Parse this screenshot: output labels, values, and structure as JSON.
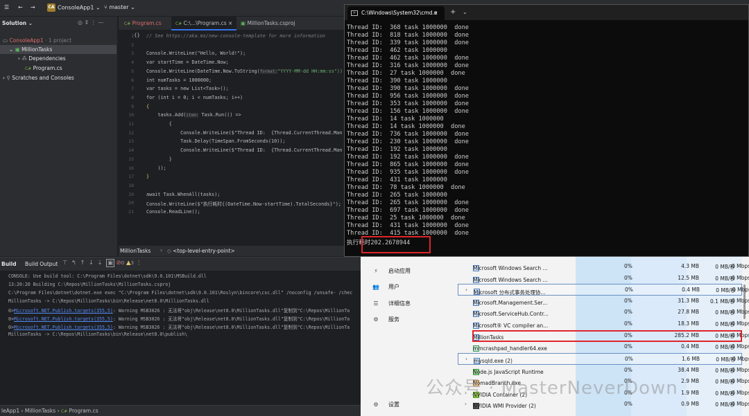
{
  "titlebar": {
    "project": "ConsoleApp1",
    "badge": "CA",
    "branch": "master"
  },
  "solution": {
    "header": "Solution",
    "rows": [
      {
        "label": "ConsoleApp1",
        "note": " · 1 project"
      },
      {
        "label": "MillionTasks"
      },
      {
        "label": "Dependencies"
      },
      {
        "label": "Program.cs"
      },
      {
        "label": "Scratches and Consoles"
      }
    ]
  },
  "tabs": [
    {
      "label": "Program.cs"
    },
    {
      "label": "C:\\...\\Program.cs"
    },
    {
      "label": "MillionTasks.csproj"
    }
  ],
  "editor": {
    "lines": [
      "1",
      "2",
      "3",
      "4",
      "5",
      "6",
      "7",
      "8",
      "9",
      "10",
      "11",
      "12",
      "13",
      "14",
      "15",
      "16",
      "17",
      "18",
      "19",
      "20",
      "21"
    ],
    "comment": "// See https://aka.ms/new-console-template for more information",
    "code": [
      "Console.WriteLine(\"Hello, World!\");",
      "var startTime = DateTime.Now;",
      "Console.WriteLine(DateTime.Now.ToString(",
      "int numTasks = 1000000;",
      "var tasks = new List<Task>();",
      "for (int i = 0; i < numTasks; i++)",
      "{",
      "    tasks.Add(",
      "        {",
      "            Console.WriteLine($\"Thread ID:  {Thread.CurrentThread.Man",
      "            Task.Delay(TimeSpan.FromSeconds(10));",
      "            Console.WriteLine($\"Thread ID:  {Thread.CurrentThread.Man",
      "        }",
      "    ));",
      "}",
      "await Task.WhenAll(tasks);",
      "Console.WriteLine($\"执行耗时{(DateTime.Now-startTime).TotalSeconds}\");",
      "Console.ReadLine();"
    ],
    "hint_format": "format:",
    "format_str": "\"YYYY-MM-dd HH:mm:ss\"))",
    "hint_item": "item:",
    "task_run": "Task.Run(() =>"
  },
  "breadcrumb": {
    "project": "MillionTasks",
    "entry": "<top-level-entry-point>"
  },
  "build": {
    "tab1": "Build",
    "tab2": "Build Output",
    "errors": "0",
    "warnings": "3",
    "lines": [
      "CONSOLE: Use build tool: C:\\Program Files\\dotnet\\sdk\\9.0.101\\MSBuild.dll",
      "13:20:20 Building C:\\Repos\\MillionTasks\\MillionTasks.csproj",
      "C:\\Program Files\\dotnet\\dotnet.exe exec \"C:\\Program Files\\dotnet\\sdk\\9.0.101\\Roslyn\\bincore\\csc.dll\" /noconfig /unsafe- /chec",
      "MillionTasks -> C:\\Repos\\MillionTasks\\bin\\Release\\net8.0\\MillionTasks.dll"
    ],
    "warn_prefix": "0>",
    "warn_link": "Microsoft.NET.Publish.targets(355,5)",
    "warnings_text": [
      ": Warning MSB3026 : 无法将\"obj\\Release\\net8.0\\MillionTasks.dll\"复制到\"C:\\Repos\\MillionTa",
      ": Warning MSB3026 : 无法将\"obj\\Release\\net8.0\\MillionTasks.dll\"复制到\"C:\\Repos\\MillionTa",
      ": Warning MSB3026 : 无法将\"obj\\Release\\net8.0\\MillionTasks.dll\"复制到\"C:\\Repos\\MillionTa"
    ],
    "last": "MillionTasks -> C:\\Repos\\MillionTasks\\bin\\Release\\net8.0\\publish\\"
  },
  "status": {
    "a": "leApp1",
    "b": "MillionTasks",
    "c": "Program.cs"
  },
  "cmd": {
    "title": "C:\\Windows\\System32\\cmd.e",
    "lines": [
      "Thread ID:  368 task 1000000  done",
      "Thread ID:  818 task 1000000  done",
      "Thread ID:  339 task 1000000  done",
      "Thread ID:  462 task 1000000",
      "Thread ID:  462 task 1000000  done",
      "Thread ID:  316 task 1000000  done",
      "Thread ID:  27 task 1000000  done",
      "Thread ID:  390 task 1000000",
      "Thread ID:  390 task 1000000  done",
      "Thread ID:  956 task 1000000  done",
      "Thread ID:  353 task 1000000  done",
      "Thread ID:  156 task 1000000  done",
      "Thread ID:  14 task 1000000",
      "Thread ID:  14 task 1000000  done",
      "Thread ID:  736 task 1000000  done",
      "Thread ID:  230 task 1000000  done",
      "Thread ID:  192 task 1000000",
      "Thread ID:  192 task 1000000  done",
      "Thread ID:  865 task 1000000  done",
      "Thread ID:  935 task 1000000  done",
      "Thread ID:  431 task 1000000",
      "Thread ID:  78 task 1000000  done",
      "Thread ID:  265 task 1000000",
      "Thread ID:  265 task 1000000  done",
      "Thread ID:  697 task 1000000  done",
      "Thread ID:  25 task 1000000  done",
      "Thread ID:  431 task 1000000  done",
      "Thread ID:  415 task 1000000  done"
    ],
    "result": "执行耗时202.2678944"
  },
  "taskmgr": {
    "nav": [
      {
        "icon": "⚡",
        "label": "启动应用"
      },
      {
        "icon": "👥",
        "label": "用户"
      },
      {
        "icon": "☰",
        "label": "详细信息"
      },
      {
        "icon": "⚙",
        "label": "服务"
      }
    ],
    "settings": "设置",
    "rows": [
      {
        "name": "Microsoft Windows Search ...",
        "cpu": "0%",
        "mem": "4.3 MB",
        "disk": "0 MB/秒",
        "net": "0 Mbps",
        "exp": false
      },
      {
        "name": "Microsoft Windows Search ...",
        "cpu": "0%",
        "mem": "12.5 MB",
        "disk": "0 MB/秒",
        "net": "0 Mbps",
        "exp": false
      },
      {
        "name": "Microsoft 分布式事务处理协...",
        "cpu": "0%",
        "mem": "0.4 MB",
        "disk": "0 MB/秒",
        "net": "0 Mbps",
        "exp": true
      },
      {
        "name": "Microsoft.Management.Ser...",
        "cpu": "0%",
        "mem": "31.3 MB",
        "disk": "0.1 MB/秒",
        "net": "0 Mbps",
        "exp": false
      },
      {
        "name": "Microsoft.ServiceHub.Contr...",
        "cpu": "0%",
        "mem": "27.8 MB",
        "disk": "0 MB/秒",
        "net": "0 Mbps",
        "exp": false
      },
      {
        "name": "Microsoft® VC compiler an...",
        "cpu": "0%",
        "mem": "18.3 MB",
        "disk": "0 MB/秒",
        "net": "0 Mbps",
        "exp": false
      },
      {
        "name": "MillionTasks",
        "cpu": "0%",
        "mem": "285.2 MB",
        "disk": "0 MB/秒",
        "net": "0 Mbps",
        "exp": false
      },
      {
        "name": "mmcrashpad_handler64.exe",
        "cpu": "0%",
        "mem": "0.4 MB",
        "disk": "0 MB/秒",
        "net": "0 Mbps",
        "exp": false
      },
      {
        "name": "mysqld.exe (2)",
        "cpu": "0%",
        "mem": "1.6 MB",
        "disk": "0 MB/秒",
        "net": "0 Mbps",
        "exp": true
      },
      {
        "name": "Node.js JavaScript Runtime",
        "cpu": "0%",
        "mem": "38.4 MB",
        "disk": "0 MB/秒",
        "net": "0 Mbps",
        "exp": false
      },
      {
        "name": "NomadBranch.exe",
        "cpu": "0%",
        "mem": "2.9 MB",
        "disk": "0 MB/秒",
        "net": "0 Mbps",
        "exp": false
      },
      {
        "name": "NVIDIA Container (2)",
        "cpu": "0%",
        "mem": "1.9 MB",
        "disk": "0 MB/秒",
        "net": "0 Mbps",
        "exp": true
      },
      {
        "name": "NVIDIA WMI Provider (2)",
        "cpu": "0%",
        "mem": "0.9 MB",
        "disk": "0 MB/秒",
        "net": "0 Mbps",
        "exp": true
      }
    ]
  },
  "watermark": "公众号 · MasterNeverDown"
}
